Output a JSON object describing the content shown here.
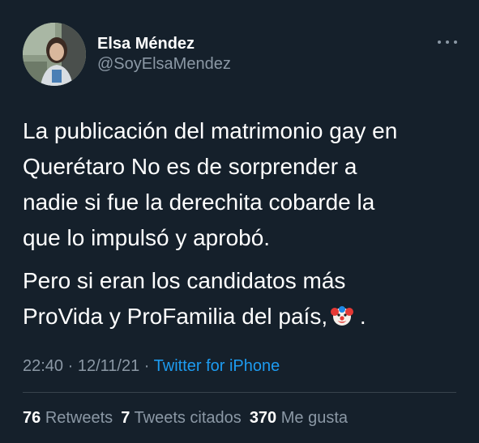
{
  "author": {
    "display_name": "Elsa Méndez",
    "handle": "@SoyElsaMendez"
  },
  "tweet": {
    "paragraph_1_lines": [
      "La publicación del matrimonio gay en",
      "Querétaro No es de sorprender a",
      "nadie si fue la derechita cobarde la",
      "que lo impulsó y aprobó."
    ],
    "paragraph_2_lines": [
      "Pero si eran los candidatos más",
      "ProVida y ProFamilia del país,"
    ],
    "paragraph_2_trailing": ".",
    "emoji": "clown-face"
  },
  "meta": {
    "time": "22:40",
    "separator_1": " · ",
    "date": "12/11/21",
    "separator_2": " · ",
    "source": "Twitter for iPhone"
  },
  "stats": {
    "retweets_count": "76",
    "retweets_label": "Retweets",
    "quote_count": "7",
    "quote_label": "Tweets citados",
    "likes_count": "370",
    "likes_label": "Me gusta"
  },
  "colors": {
    "background": "#15202b",
    "primary_text": "#ffffff",
    "secondary_text": "#8b98a5",
    "link": "#1d9bf0",
    "divider": "#38444d"
  }
}
